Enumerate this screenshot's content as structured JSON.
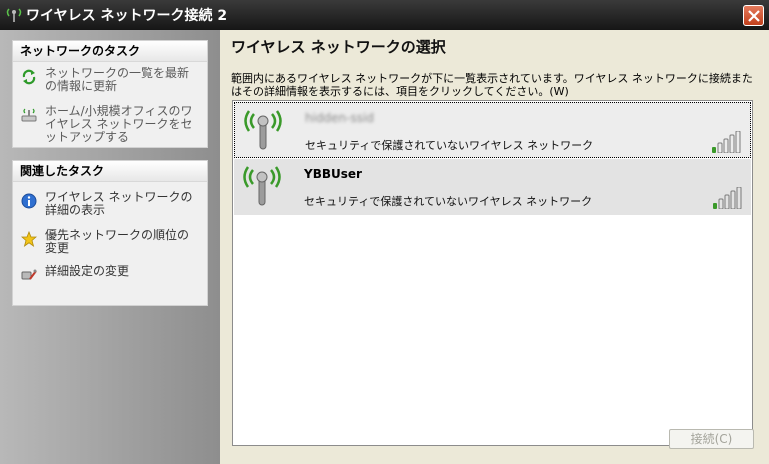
{
  "window": {
    "title": "ワイヤレス ネットワーク接続 2"
  },
  "left_panels": {
    "network_tasks": {
      "heading": "ネットワークのタスク",
      "items": [
        {
          "label": "ネットワークの一覧を最新の情報に更新",
          "icon": "refresh-icon"
        },
        {
          "label": "ホーム/小規模オフィスのワイヤレス ネットワークをセットアップする",
          "icon": "wireless-setup-icon"
        }
      ]
    },
    "related_tasks": {
      "heading": "関連したタスク",
      "items": [
        {
          "label": "ワイヤレス ネットワークの詳細の表示",
          "icon": "info-icon"
        },
        {
          "label": "優先ネットワークの順位の変更",
          "icon": "star-icon"
        },
        {
          "label": "詳細設定の変更",
          "icon": "settings-icon"
        }
      ]
    }
  },
  "main": {
    "title": "ワイヤレス ネットワークの選択",
    "description": "範囲内にあるワイヤレス ネットワークが下に一覧表示されています。ワイヤレス ネットワークに接続またはその詳細情報を表示するには、項目をクリックしてください。(W)",
    "networks": [
      {
        "ssid": "hidden-ssid",
        "security": "セキュリティで保護されていないワイヤレス ネットワーク",
        "signal_bars": 1,
        "selected": true
      },
      {
        "ssid": "YBBUser",
        "security": "セキュリティで保護されていないワイヤレス ネットワーク",
        "signal_bars": 1,
        "selected": false
      }
    ],
    "connect_button": "接続(C)"
  },
  "colors": {
    "titlebar": "#222222",
    "left_pane": "#a4a4a4",
    "signal_on": "#3a9a2a",
    "signal_off": "#7a7a7a"
  }
}
